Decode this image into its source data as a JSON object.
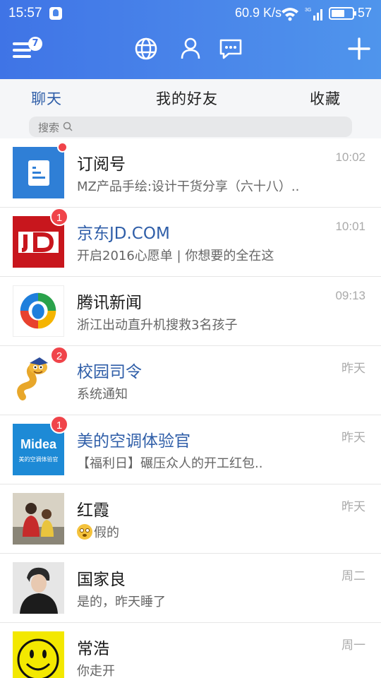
{
  "status_bar": {
    "time": "15:57",
    "speed": "60.9 K/s",
    "battery": "57"
  },
  "toolbar": {
    "menu_badge": "7"
  },
  "tabs": [
    {
      "label": "聊天",
      "active": true
    },
    {
      "label": "我的好友",
      "active": false
    },
    {
      "label": "收藏",
      "active": false
    }
  ],
  "search": {
    "placeholder": "搜索"
  },
  "colors": {
    "header": "#4a86ea",
    "accent": "#2f5ea8",
    "badge": "#f0444a"
  },
  "conversations": [
    {
      "name": "订阅号",
      "message": "MZ产品手绘:设计干货分享（六十八）..",
      "time": "10:02",
      "avatar": "subscription-icon",
      "indicator": "dot"
    },
    {
      "name": "京东JD.COM",
      "message": "开启2016心愿单 | 你想要的全在这",
      "time": "10:01",
      "avatar": "jd-logo",
      "badge": "1"
    },
    {
      "name": "腾讯新闻",
      "message": "浙江出动直升机搜救3名孩子",
      "time": "09:13",
      "avatar": "tencent-news-logo"
    },
    {
      "name": "校园司令",
      "message": "系统通知",
      "time": "昨天",
      "avatar": "campus-mascot",
      "badge": "2"
    },
    {
      "name": "美的空调体验官",
      "message": "【福利日】碾压众人的开工红包..",
      "time": "昨天",
      "avatar": "midea-logo",
      "badge": "1",
      "avatar_text": "Midea",
      "avatar_sub": "美的空调体验官"
    },
    {
      "name": "红霞",
      "message": "假的",
      "time": "昨天",
      "avatar": "photo-avatar"
    },
    {
      "name": "国家良",
      "message": "是的，昨天睡了",
      "time": "周二",
      "avatar": "photo-avatar"
    },
    {
      "name": "常浩",
      "message": "你走开",
      "time": "周一",
      "avatar": "smiley-avatar"
    }
  ]
}
